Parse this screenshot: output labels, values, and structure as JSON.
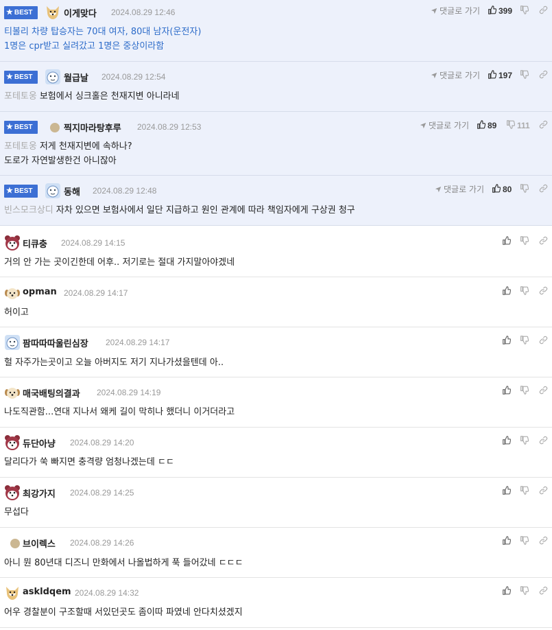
{
  "best_label": "BEST",
  "reply_label": "댓글로 가기",
  "colors": {
    "best_bg": "#edf1fb",
    "badge": "#3c6fd4",
    "link_text": "#2c6bc9"
  },
  "comments": [
    {
      "nick": "이게맞다",
      "date": "2024.08.29 12:46",
      "likes": "399",
      "dislikes": "",
      "quote": "",
      "lines": [
        "티볼리 차량 탑승자는 70대 여자, 80대 남자(운전자)",
        "1명은 cpr받고 실려갔고 1명은 중상이라함"
      ],
      "avatar": "dog-icon"
    },
    {
      "nick": "월급날",
      "date": "2024.08.29 12:54",
      "likes": "197",
      "dislikes": "",
      "quote": "포테토웅",
      "lines": [
        "보험에서 싱크홀은 천재지변 아니라네"
      ],
      "avatar": "character-icon"
    },
    {
      "nick": "찍지마라탕후루",
      "date": "2024.08.29 12:53",
      "likes": "89",
      "dislikes": "111",
      "quote": "포테토웅",
      "lines": [
        "저게 천재지변에 속하나?",
        "도로가 자연발생한건 아니잖아"
      ],
      "avatar": "dot-icon"
    },
    {
      "nick": "동해",
      "date": "2024.08.29 12:48",
      "likes": "80",
      "dislikes": "",
      "quote": "빈스모크상디",
      "lines": [
        "자차 있으면 보험사에서 일단 지급하고 원인 관계에 따라 책임자에게 구상권 청구"
      ],
      "avatar": "character-icon"
    },
    {
      "nick": "티큐충",
      "date": "2024.08.29 14:15",
      "quote": "",
      "lines": [
        "거의 안 가는 곳이긴한데 어후.. 저기로는 절대 가지말아야겠네"
      ],
      "avatar": "animal-icon"
    },
    {
      "nick": "opman",
      "date": "2024.08.29 14:17",
      "quote": "",
      "lines": [
        "허이고"
      ],
      "avatar": "puppy-icon"
    },
    {
      "nick": "팜따따따울린심장",
      "date": "2024.08.29 14:17",
      "quote": "",
      "lines": [
        "헐 자주가는곳이고 오늘 아버지도 저기 지나가셨을텐데 아.."
      ],
      "avatar": "character-icon"
    },
    {
      "nick": "매국배팅의결과",
      "date": "2024.08.29 14:19",
      "quote": "",
      "lines": [
        "나도직관함...연대 지나서 왜케 길이 막히나 했더니 이거더라고"
      ],
      "avatar": "puppy-icon"
    },
    {
      "nick": "듀단아냥",
      "date": "2024.08.29 14:20",
      "quote": "",
      "lines": [
        "달리다가 쑥 빠지면 충격량 엄청나겠는데 ㄷㄷ"
      ],
      "avatar": "animal-icon"
    },
    {
      "nick": "최강가지",
      "date": "2024.08.29 14:25",
      "quote": "",
      "lines": [
        "무섭다"
      ],
      "avatar": "animal-icon"
    },
    {
      "nick": "브이렉스",
      "date": "2024.08.29 14:26",
      "quote": "",
      "lines": [
        "아니 뭔 80년대 디즈니 만화에서 나올법하게 푹 들어갔네 ㄷㄷㄷ"
      ],
      "avatar": "dot-icon"
    },
    {
      "nick": "askldqem",
      "date": "2024.08.29 14:32",
      "quote": "",
      "lines": [
        "어우 경찰분이 구조할때 서있던곳도 좀이따 파였네 안다치셨겠지"
      ],
      "avatar": "dog-icon"
    }
  ]
}
